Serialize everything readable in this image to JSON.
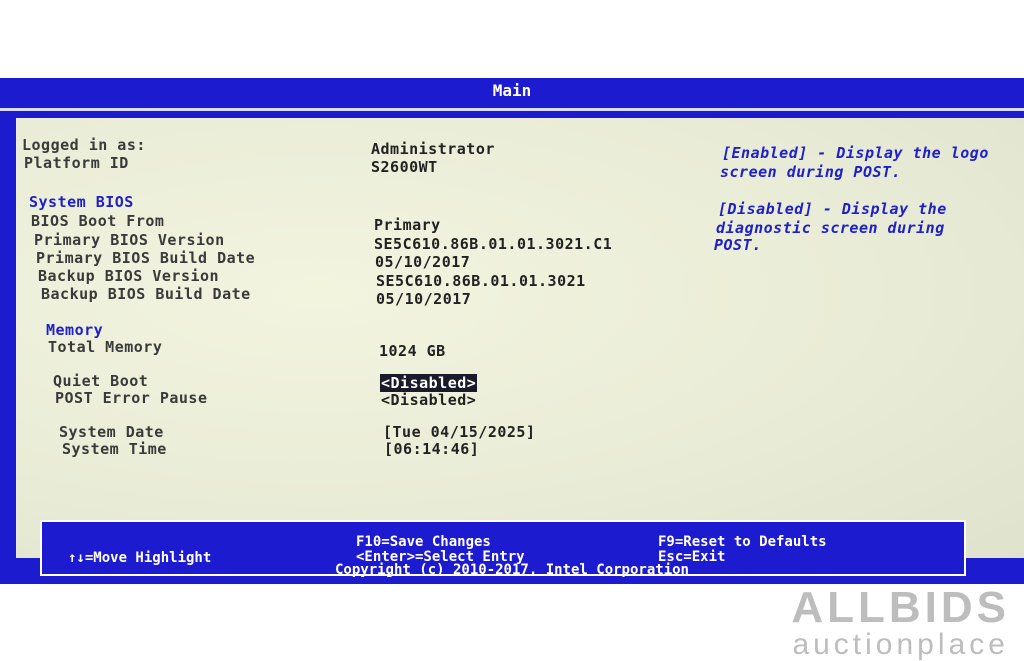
{
  "title": "Main",
  "session": {
    "logged_in_label": "Logged in as:",
    "logged_in_value": "Administrator",
    "platform_label": "Platform ID",
    "platform_value": "S2600WT"
  },
  "system_bios": {
    "header": "System BIOS",
    "boot_from_label": "BIOS Boot From",
    "boot_from_value": "Primary",
    "primary_version_label": "Primary BIOS Version",
    "primary_version_value": "SE5C610.86B.01.01.3021.C1",
    "primary_date_label": "Primary BIOS Build Date",
    "primary_date_value": "05/10/2017",
    "backup_version_label": "Backup BIOS Version",
    "backup_version_value": "SE5C610.86B.01.01.3021",
    "backup_date_label": "Backup BIOS Build Date",
    "backup_date_value": "05/10/2017"
  },
  "memory": {
    "header": "Memory",
    "total_label": "Total Memory",
    "total_value": "1024 GB"
  },
  "options": {
    "quiet_boot_label": "Quiet Boot",
    "quiet_boot_value": "<Disabled>",
    "post_error_label": "POST Error Pause",
    "post_error_value": "<Disabled>"
  },
  "datetime": {
    "date_label": "System Date",
    "date_value": "[Tue 04/15/2025]",
    "time_label": "System Time",
    "time_value": "[06:14:46]"
  },
  "help": {
    "line1": "[Enabled] - Display the logo",
    "line2": "screen during POST.",
    "line3": "[Disabled] - Display the",
    "line4": "diagnostic screen during",
    "line5": "POST."
  },
  "footer": {
    "move": "↑↓=Move Highlight",
    "save": "F10=Save Changes",
    "select": "<Enter>=Select Entry",
    "reset": "F9=Reset to Defaults",
    "exit": "Esc=Exit"
  },
  "copyright": "Copyright (c) 2010-2017, Intel Corporation",
  "watermark": {
    "brand": "ALLBIDS",
    "tagline": "auctionplace"
  }
}
